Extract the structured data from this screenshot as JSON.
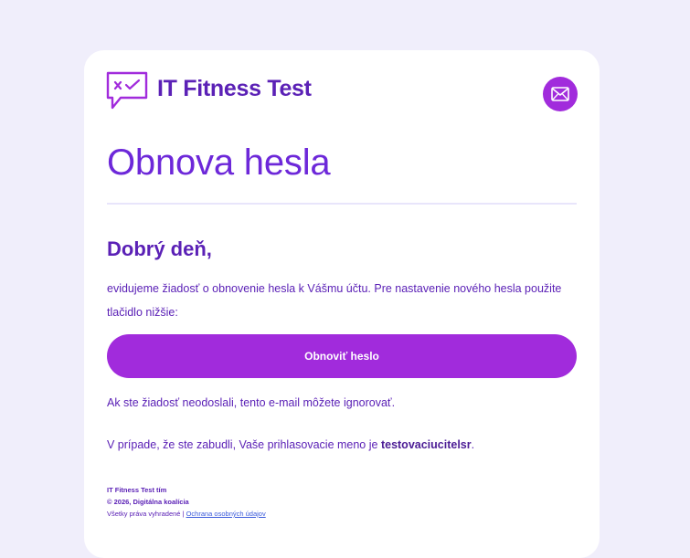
{
  "email": {
    "brand_name": "IT Fitness Test",
    "title": "Obnova hesla",
    "greeting": "Dobrý deň,",
    "intro": "evidujeme žiadosť o obnovenie hesla k Vášmu účtu. Pre nastavenie nového hesla použite tlačidlo nižšie:",
    "cta_label": "Obnoviť heslo",
    "ignore_note": "Ak ste žiadosť neodoslali, tento e-mail môžete ignorovať.",
    "username_note_prefix": "V prípade, že ste zabudli, Vaše prihlasovacie meno je ",
    "username": "testovaciucitelsr",
    "username_note_suffix": ".",
    "footer": {
      "team": "IT Fitness Test tím",
      "copyright": "© 2026, Digitálna koalícia",
      "rights": "Všetky práva vyhradené | ",
      "privacy_link": "Ochrana osobných údajov"
    }
  },
  "icons": {
    "logo": "checkmark-speech-bubble-icon",
    "mail": "envelope-icon"
  },
  "colors": {
    "background": "#f0eefb",
    "card": "#ffffff",
    "primary": "#a12bdc",
    "text": "#5b21b6",
    "divider": "#e8e5fb",
    "link": "#3b5bdb"
  }
}
